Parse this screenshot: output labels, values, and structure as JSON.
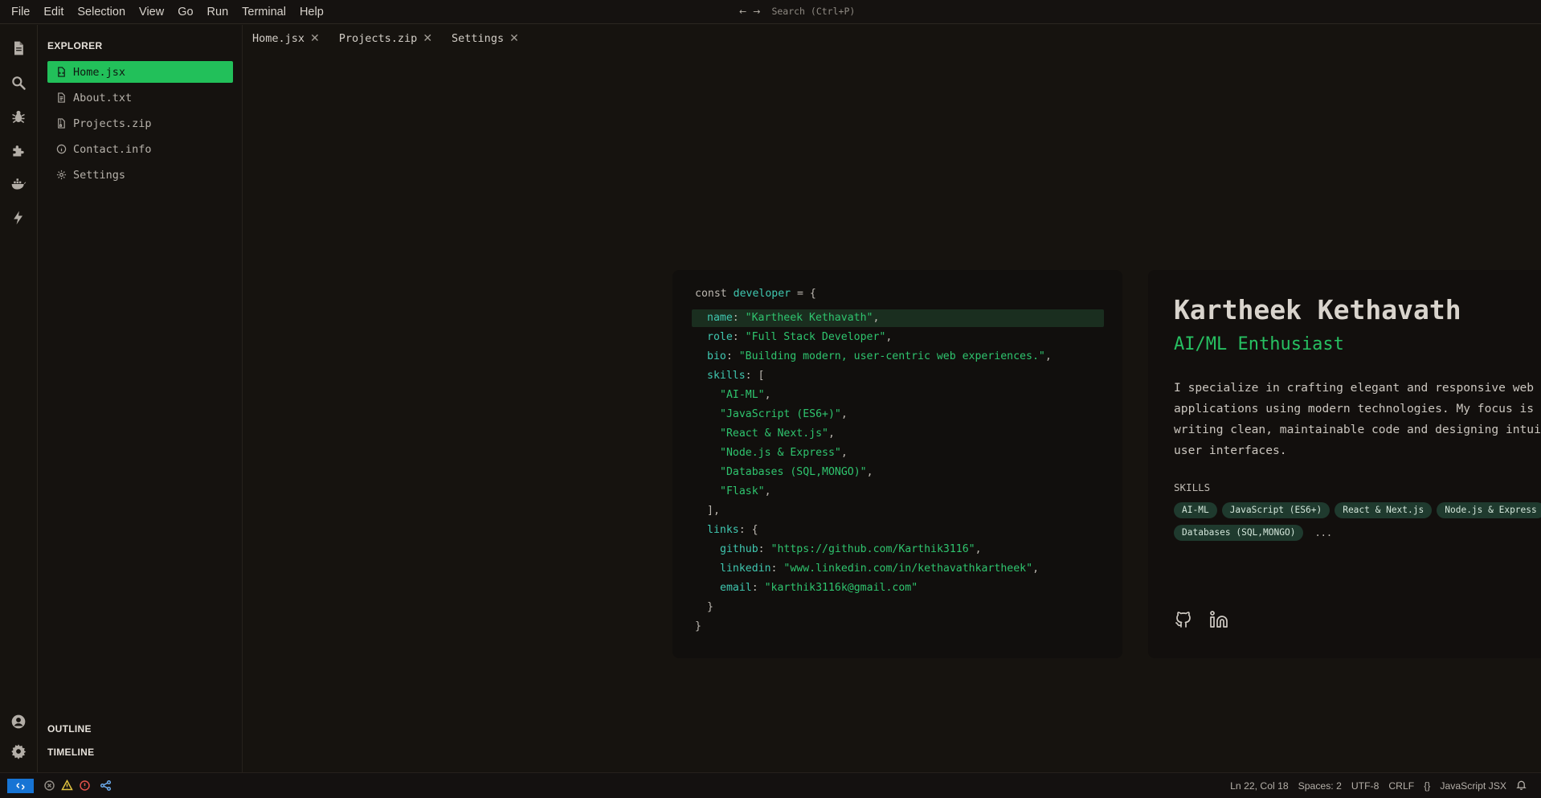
{
  "menubar": {
    "items": [
      "File",
      "Edit",
      "Selection",
      "View",
      "Go",
      "Run",
      "Terminal",
      "Help"
    ],
    "back_arrow": "←",
    "forward_arrow": "→",
    "search_placeholder": "Search (Ctrl+P)"
  },
  "activitybar": {
    "top_icons": [
      "files-icon",
      "search-icon",
      "debug-icon",
      "extensions-icon",
      "docker-icon",
      "lightning-icon"
    ],
    "bottom_icons": [
      "account-icon",
      "settings-gear-icon"
    ]
  },
  "sidebar": {
    "title": "EXPLORER",
    "files": [
      {
        "label": "Home.jsx",
        "icon": "jsx-file-icon",
        "active": true
      },
      {
        "label": "About.txt",
        "icon": "text-file-icon",
        "active": false
      },
      {
        "label": "Projects.zip",
        "icon": "zip-file-icon",
        "active": false
      },
      {
        "label": "Contact.info",
        "icon": "info-icon",
        "active": false
      },
      {
        "label": "Settings",
        "icon": "gear-icon",
        "active": false
      }
    ],
    "outline_label": "OUTLINE",
    "timeline_label": "TIMELINE"
  },
  "tabs": [
    {
      "label": "Home.jsx",
      "close": "✕"
    },
    {
      "label": "Projects.zip",
      "close": "✕"
    },
    {
      "label": "Settings",
      "close": "✕"
    }
  ],
  "code": {
    "line1_kw": "const ",
    "line1_var": "developer",
    "line1_rest": " = {",
    "name_key": "name",
    "name_val": "\"Kartheek Kethavath\"",
    "role_key": "role",
    "role_val": "\"Full Stack Developer\"",
    "bio_key": "bio",
    "bio_val": "\"Building modern, user-centric web experiences.\"",
    "skills_key": "skills",
    "skills": [
      "\"AI-ML\"",
      "\"JavaScript (ES6+)\"",
      "\"React & Next.js\"",
      "\"Node.js & Express\"",
      "\"Databases (SQL,MONGO)\"",
      "\"Flask\""
    ],
    "skills_close": "],",
    "links_key": "links",
    "github_key": "github",
    "github_val": "\"https://github.com/Karthik3116\"",
    "linkedin_key": "linkedin",
    "linkedin_val": "\"www.linkedin.com/in/kethavathkartheek\"",
    "email_key": "email",
    "email_val": "\"karthik3116k@gmail.com\"",
    "links_close": "}",
    "obj_close": "}"
  },
  "profile": {
    "name": "Kartheek Kethavath",
    "role": "AI/ML Enthusiast",
    "bio": "I specialize in crafting elegant and responsive web applications using modern technologies. My focus is on writing clean, maintainable code and designing intuitive user interfaces.",
    "skills_title": "SKILLS",
    "skills": [
      "AI-ML",
      "JavaScript (ES6+)",
      "React & Next.js",
      "Node.js & Express",
      "Databases (SQL,MONGO)"
    ],
    "more": "...",
    "socials": [
      "github-icon",
      "linkedin-icon"
    ]
  },
  "statusbar": {
    "position": "Ln 22, Col 18",
    "spaces": "Spaces: 2",
    "encoding": "UTF-8",
    "eol": "CRLF",
    "braces": "{}",
    "language": "JavaScript JSX",
    "colors": {
      "remote": "#1774d4",
      "warning": "#e0c341",
      "error": "#e0524a",
      "accent": "#22c05a"
    }
  }
}
